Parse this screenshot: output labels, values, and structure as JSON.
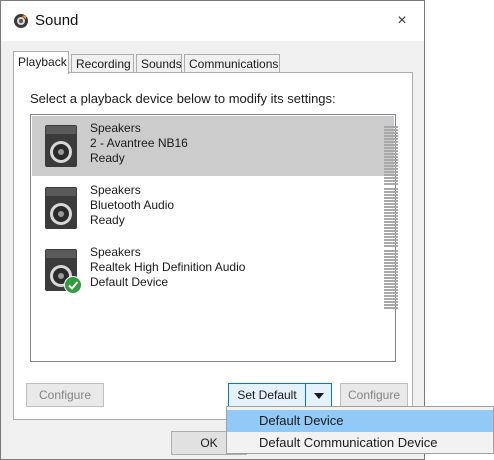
{
  "window": {
    "title": "Sound",
    "close_glyph": "×"
  },
  "tabs": [
    {
      "label": "Playback",
      "active": true
    },
    {
      "label": "Recording",
      "active": false
    },
    {
      "label": "Sounds",
      "active": false
    },
    {
      "label": "Communications",
      "active": false
    }
  ],
  "playback": {
    "instruction": "Select a playback device below to modify its settings:",
    "devices": [
      {
        "name": "Speakers",
        "description": "2 - Avantree NB16",
        "status": "Ready",
        "selected": true,
        "default": false,
        "icon": "speaker-icon"
      },
      {
        "name": "Speakers",
        "description": "Bluetooth Audio",
        "status": "Ready",
        "selected": false,
        "default": false,
        "icon": "speaker-icon"
      },
      {
        "name": "Speakers",
        "description": "Realtek High Definition Audio",
        "status": "Default Device",
        "selected": false,
        "default": true,
        "icon": "speaker-icon"
      }
    ]
  },
  "buttons": {
    "configure_left": "Configure",
    "set_default": "Set Default",
    "configure_right": "Configure",
    "ok": "OK"
  },
  "set_default_menu": {
    "items": [
      {
        "label": "Default Device",
        "highlighted": true
      },
      {
        "label": "Default Communication Device",
        "highlighted": false
      }
    ]
  },
  "colors": {
    "selection": "#cccccc",
    "menu_highlight": "#91c9f7",
    "default_check": "#2e9c3e",
    "focus_border": "#0078d7"
  }
}
